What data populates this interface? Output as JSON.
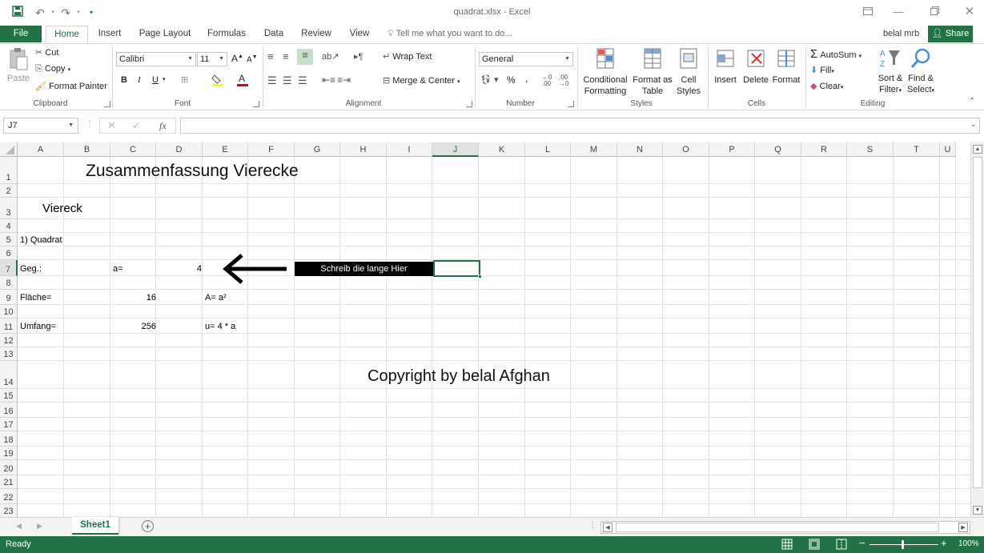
{
  "window": {
    "title": "quadrat.xlsx - Excel",
    "user": "belal mrb",
    "share_label": "Share"
  },
  "tabs": [
    "File",
    "Home",
    "Insert",
    "Page Layout",
    "Formulas",
    "Data",
    "Review",
    "View"
  ],
  "tell_me": "Tell me what you want to do...",
  "ribbon": {
    "clipboard": {
      "label": "Clipboard",
      "paste": "Paste",
      "cut": "Cut",
      "copy": "Copy",
      "format_painter": "Format Painter"
    },
    "font": {
      "label": "Font",
      "name": "Calibri",
      "size": "11"
    },
    "alignment": {
      "label": "Alignment",
      "wrap": "Wrap Text",
      "merge": "Merge & Center"
    },
    "number": {
      "label": "Number",
      "format": "General",
      "percent": "%",
      "comma": ","
    },
    "styles": {
      "label": "Styles",
      "conditional": "Conditional",
      "conditional2": "Formatting",
      "format_as": "Format as",
      "format_as2": "Table",
      "cell_styles": "Cell",
      "cell_styles2": "Styles"
    },
    "cells": {
      "label": "Cells",
      "insert": "Insert",
      "delete": "Delete",
      "format": "Format"
    },
    "editing": {
      "label": "Editing",
      "autosum": "AutoSum",
      "fill": "Fill",
      "clear": "Clear",
      "sort": "Sort &",
      "sort2": "Filter",
      "find": "Find &",
      "find2": "Select"
    }
  },
  "formula_bar": {
    "name_box": "J7",
    "fx": "fx",
    "value": ""
  },
  "columns": [
    "A",
    "B",
    "C",
    "D",
    "E",
    "F",
    "G",
    "H",
    "I",
    "J",
    "K",
    "L",
    "M",
    "N",
    "O",
    "P",
    "Q",
    "R",
    "S",
    "T",
    "U"
  ],
  "rows": [
    "1",
    "2",
    "3",
    "4",
    "5",
    "6",
    "7",
    "8",
    "9",
    "10",
    "11",
    "12",
    "13",
    "14",
    "15",
    "16",
    "17",
    "18",
    "19",
    "20",
    "21",
    "22",
    "23"
  ],
  "cells": {
    "title": "Zusammenfassung Vierecke",
    "viereck": "Viereck",
    "quadrat": "1) Quadrat",
    "geg": "Geg.:",
    "a_eq": "a=",
    "a_val": "4",
    "box_text": "Schreib die lange Hier",
    "flaeche": "Fläche=",
    "flaeche_val": "16",
    "flaeche_formula": "A= a²",
    "umfang": "Umfang=",
    "umfang_val": "256",
    "umfang_formula": "u= 4 * a",
    "copyright": "Copyright by belal Afghan"
  },
  "sheet": {
    "name": "Sheet1"
  },
  "status": {
    "ready": "Ready",
    "zoom": "100%"
  }
}
